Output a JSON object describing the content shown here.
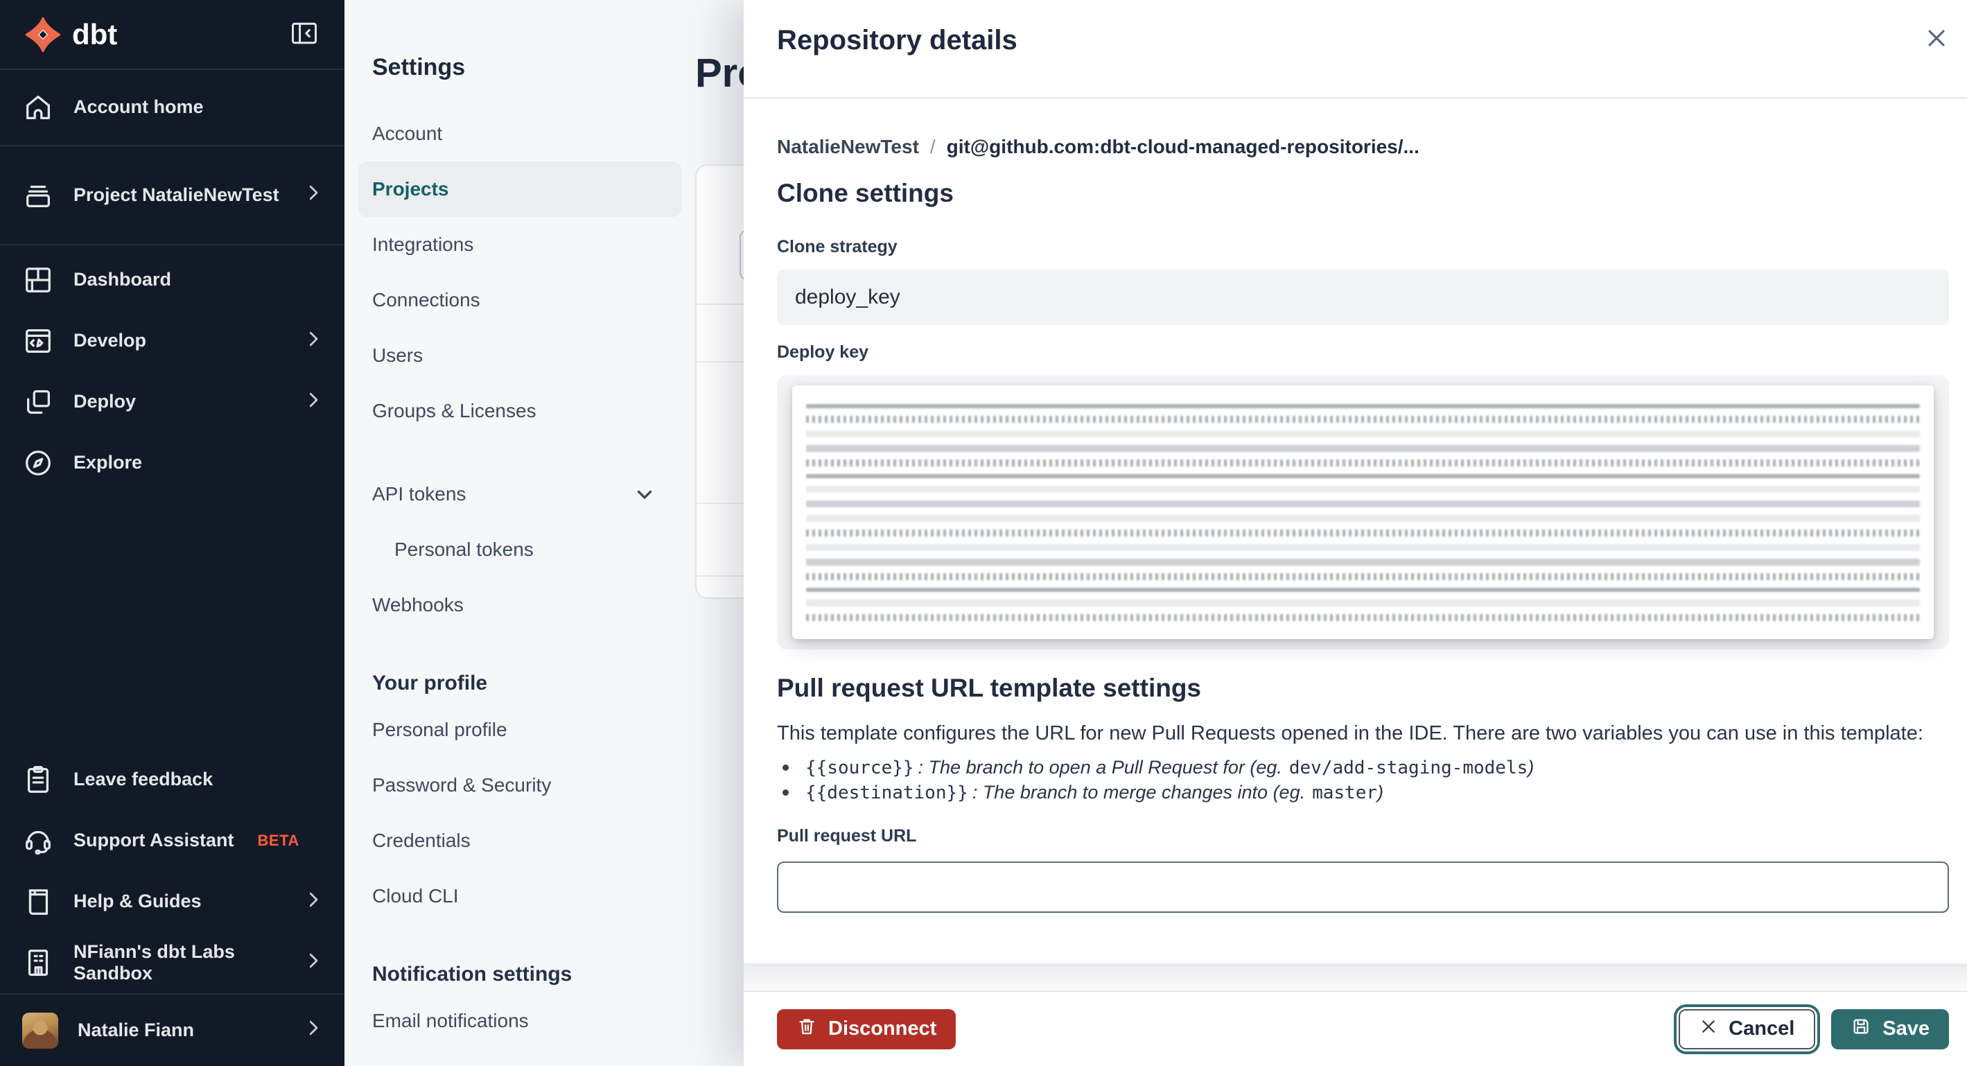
{
  "app": {
    "logo_text": "dbt"
  },
  "colors": {
    "sidebar_bg": "#131A27",
    "logo_orange": "#ED6A4D",
    "accent_teal": "#2F6C6E",
    "selected_link_teal": "#14606A",
    "danger_red": "#B22F27",
    "beta_orange": "#FF5C3C",
    "text_navy": "#1F2A3D"
  },
  "sidebar": {
    "collapse_icon": "collapse-sidebar-icon",
    "items": [
      {
        "label": "Account home",
        "icon": "home-icon",
        "chevron": false
      },
      {
        "label": "Project NatalieNewTest",
        "icon": "project-icon",
        "chevron": true
      },
      {
        "label": "Dashboard",
        "icon": "dashboard-icon",
        "chevron": false
      },
      {
        "label": "Develop",
        "icon": "develop-icon",
        "chevron": true
      },
      {
        "label": "Deploy",
        "icon": "deploy-icon",
        "chevron": true
      },
      {
        "label": "Explore",
        "icon": "explore-icon",
        "chevron": false
      }
    ],
    "footer_items": [
      {
        "label": "Leave feedback",
        "icon": "clipboard-icon",
        "chevron": false
      },
      {
        "label": "Support Assistant",
        "badge": "BETA",
        "icon": "headset-icon",
        "chevron": false
      },
      {
        "label": "Help & Guides",
        "icon": "book-icon",
        "chevron": true
      },
      {
        "label": "NFiann's dbt Labs Sandbox",
        "icon": "building-icon",
        "chevron": true
      }
    ],
    "user": {
      "name": "Natalie Fiann",
      "chevron": true
    }
  },
  "settings_nav": {
    "title": "Settings",
    "items": [
      {
        "label": "Account"
      },
      {
        "label": "Projects",
        "selected": true
      },
      {
        "label": "Integrations"
      },
      {
        "label": "Connections"
      },
      {
        "label": "Users"
      },
      {
        "label": "Groups & Licenses"
      },
      {
        "label": "API tokens",
        "chevron": "down"
      },
      {
        "label": "Personal tokens",
        "indent": true
      },
      {
        "label": "Webhooks"
      }
    ],
    "profile_heading": "Your profile",
    "profile_items": [
      {
        "label": "Personal profile"
      },
      {
        "label": "Password & Security"
      },
      {
        "label": "Credentials"
      },
      {
        "label": "Cloud CLI"
      }
    ],
    "notification_heading": "Notification settings",
    "notification_items": [
      {
        "label": "Email notifications"
      }
    ]
  },
  "main": {
    "title": "Projects"
  },
  "drawer": {
    "title": "Repository details",
    "breadcrumb": {
      "project": "NatalieNewTest",
      "separator": "/",
      "repo": "git@github.com:dbt-cloud-managed-repositories/..."
    },
    "clone": {
      "heading": "Clone settings",
      "strategy_label": "Clone strategy",
      "strategy_value": "deploy_key",
      "deploy_key_label": "Deploy key"
    },
    "pr": {
      "heading": "Pull request URL template settings",
      "description": "This template configures the URL for new Pull Requests opened in the IDE. There are two variables you can use in this template:",
      "bullets": [
        {
          "code": "{{source}}",
          "text": ": The branch to open a Pull Request for (eg.",
          "example": "dev/add-staging-models",
          "suffix": ")"
        },
        {
          "code": "{{destination}}",
          "text": ": The branch to merge changes into (eg.",
          "example": "master",
          "suffix": ")"
        }
      ],
      "url_label": "Pull request URL",
      "url_value": ""
    },
    "footer": {
      "disconnect_label": "Disconnect",
      "cancel_label": "Cancel",
      "save_label": "Save"
    }
  }
}
